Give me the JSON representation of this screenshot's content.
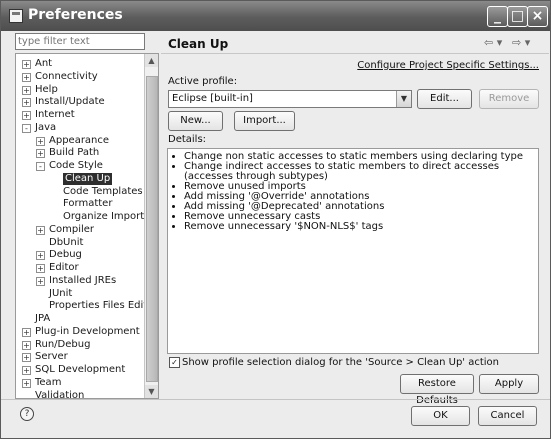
{
  "window": {
    "title": "Preferences"
  },
  "filter": {
    "placeholder": "type filter text"
  },
  "tree": {
    "items": [
      {
        "label": "Ant",
        "expander": "+"
      },
      {
        "label": "Connectivity",
        "expander": "+"
      },
      {
        "label": "Help",
        "expander": "+"
      },
      {
        "label": "Install/Update",
        "expander": "+"
      },
      {
        "label": "Internet",
        "expander": "+"
      },
      {
        "label": "Java",
        "expander": "-"
      },
      {
        "label": "Appearance",
        "expander": "+"
      },
      {
        "label": "Build Path",
        "expander": "+"
      },
      {
        "label": "Code Style",
        "expander": "-"
      },
      {
        "label": "Clean Up",
        "expander": ""
      },
      {
        "label": "Code Templates",
        "expander": ""
      },
      {
        "label": "Formatter",
        "expander": ""
      },
      {
        "label": "Organize Imports",
        "expander": ""
      },
      {
        "label": "Compiler",
        "expander": "+"
      },
      {
        "label": "DbUnit",
        "expander": ""
      },
      {
        "label": "Debug",
        "expander": "+"
      },
      {
        "label": "Editor",
        "expander": "+"
      },
      {
        "label": "Installed JREs",
        "expander": "+"
      },
      {
        "label": "JUnit",
        "expander": ""
      },
      {
        "label": "Properties Files Editor",
        "expander": ""
      },
      {
        "label": "JPA",
        "expander": ""
      },
      {
        "label": "Plug-in Development",
        "expander": "+"
      },
      {
        "label": "Run/Debug",
        "expander": "+"
      },
      {
        "label": "Server",
        "expander": "+"
      },
      {
        "label": "SQL Development",
        "expander": "+"
      },
      {
        "label": "Team",
        "expander": "+"
      },
      {
        "label": "Validation",
        "expander": ""
      }
    ],
    "selected": "Clean Up"
  },
  "page": {
    "title": "Clean Up",
    "configure_link": "Configure Project Specific Settings...",
    "active_profile_label": "Active profile:",
    "profile_value": "Eclipse [built-in]",
    "edit_button": "Edit...",
    "remove_button": "Remove",
    "new_button": "New...",
    "import_button": "Import...",
    "details_label": "Details:",
    "details": [
      "Change non static accesses to static members using declaring type",
      "Change indirect accesses to static members to direct accesses (accesses through subtypes)",
      "Remove unused imports",
      "Add missing '@Override' annotations",
      "Add missing '@Deprecated' annotations",
      "Remove unnecessary casts",
      "Remove unnecessary '$NON-NLS$' tags"
    ],
    "show_dialog_checkbox": "Show profile selection dialog for the 'Source > Clean Up' action",
    "show_dialog_checked": true,
    "restore_defaults_button": "Restore Defaults",
    "apply_button": "Apply"
  },
  "footer": {
    "ok_button": "OK",
    "cancel_button": "Cancel"
  }
}
